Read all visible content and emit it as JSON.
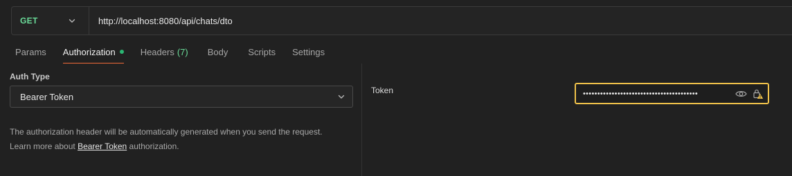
{
  "request": {
    "method": "GET",
    "url": "http://localhost:8080/api/chats/dto"
  },
  "tabs": [
    {
      "label": "Params"
    },
    {
      "label": "Authorization"
    },
    {
      "label": "Headers",
      "count": "(7)"
    },
    {
      "label": "Body"
    },
    {
      "label": "Scripts"
    },
    {
      "label": "Settings"
    }
  ],
  "auth": {
    "type_label": "Auth Type",
    "type_value": "Bearer Token",
    "description_line1": "The authorization header will be automatically generated when you send the request.",
    "description_prefix": "Learn more about ",
    "description_link": "Bearer Token",
    "description_suffix": " authorization."
  },
  "token": {
    "label": "Token",
    "masked_value": "••••••••••••••••••••••••••••••••••••••••"
  },
  "colors": {
    "method_get": "#6bdd9a",
    "active_tab_underline": "#f26b3a",
    "active_dot": "#2bb673",
    "focus_border": "#f0c24a",
    "warning": "#f0c24a"
  },
  "icons": {
    "method_dropdown": "chevron-down-icon",
    "auth_dropdown": "chevron-down-icon",
    "reveal": "eye-icon",
    "lock_warning": "lock-warning-icon"
  }
}
